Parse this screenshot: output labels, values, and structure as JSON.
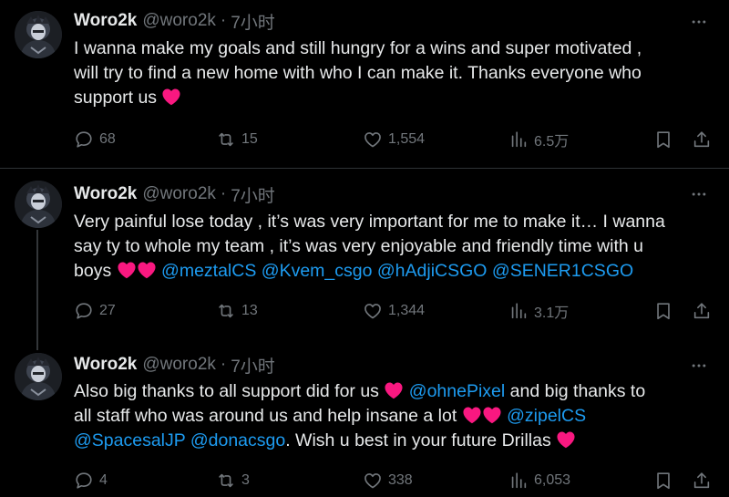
{
  "tweets": [
    {
      "author": {
        "name": "Woro2k",
        "handle": "@woro2k",
        "separator": "·",
        "time": "7小时"
      },
      "lines": [
        [
          {
            "t": "I  wanna make my goals and still hungry for  a wins and super motivated ,"
          }
        ],
        [
          {
            "t": "will try to find a new home  with who I can make it. Thanks everyone who"
          }
        ],
        [
          {
            "t": "support us "
          },
          {
            "heart": true
          }
        ]
      ],
      "stats": {
        "replies": "68",
        "reposts": "15",
        "likes": "1,554",
        "views": "6.5万"
      }
    },
    {
      "author": {
        "name": "Woro2k",
        "handle": "@woro2k",
        "separator": "·",
        "time": "7小时"
      },
      "lines": [
        [
          {
            "t": "Very painful lose today , it’s was very important for me to make it… I wanna"
          }
        ],
        [
          {
            "t": "say ty to whole my team , it’s was very enjoyable and friendly time with u"
          }
        ],
        [
          {
            "t": "boys "
          },
          {
            "heart": true
          },
          {
            "heart": true
          },
          {
            "t": "  "
          },
          {
            "m": "@meztalCS"
          },
          {
            "t": " "
          },
          {
            "m": "@Kvem_csgo"
          },
          {
            "t": " "
          },
          {
            "m": "@hAdjiCSGO"
          },
          {
            "t": " "
          },
          {
            "m": "@SENER1CSGO"
          }
        ]
      ],
      "stats": {
        "replies": "27",
        "reposts": "13",
        "likes": "1,344",
        "views": "3.1万"
      }
    },
    {
      "author": {
        "name": "Woro2k",
        "handle": "@woro2k",
        "separator": "·",
        "time": "7小时"
      },
      "lines": [
        [
          {
            "t": "Also big thanks to all support  did for us "
          },
          {
            "heart": true
          },
          {
            "t": " "
          },
          {
            "m": "@ohnePixel"
          },
          {
            "t": " and big thanks to"
          }
        ],
        [
          {
            "t": "all staff who was around us and help  insane a lot "
          },
          {
            "heart": true
          },
          {
            "heart": true
          },
          {
            "t": " "
          },
          {
            "m": "@zipelCS"
          }
        ],
        [
          {
            "m": "@SpacesalJP"
          },
          {
            "t": " "
          },
          {
            "m": "@donacsgo"
          },
          {
            "t": ". Wish u best in your future Drillas "
          },
          {
            "heart": true
          }
        ]
      ],
      "stats": {
        "replies": "4",
        "reposts": "3",
        "likes": "338",
        "views": "6,053"
      }
    }
  ],
  "colors": {
    "background": "#000000",
    "text": "#e7e9ea",
    "muted": "#71767b",
    "link": "#1d9bf0",
    "heart": "#f91880",
    "divider": "#2f3336"
  },
  "icons": {
    "more": "more-dots-icon",
    "reply": "reply-icon",
    "repost": "repost-icon",
    "like": "like-heart-icon",
    "views": "views-bar-chart-icon",
    "bookmark": "bookmark-icon",
    "share": "share-icon"
  }
}
